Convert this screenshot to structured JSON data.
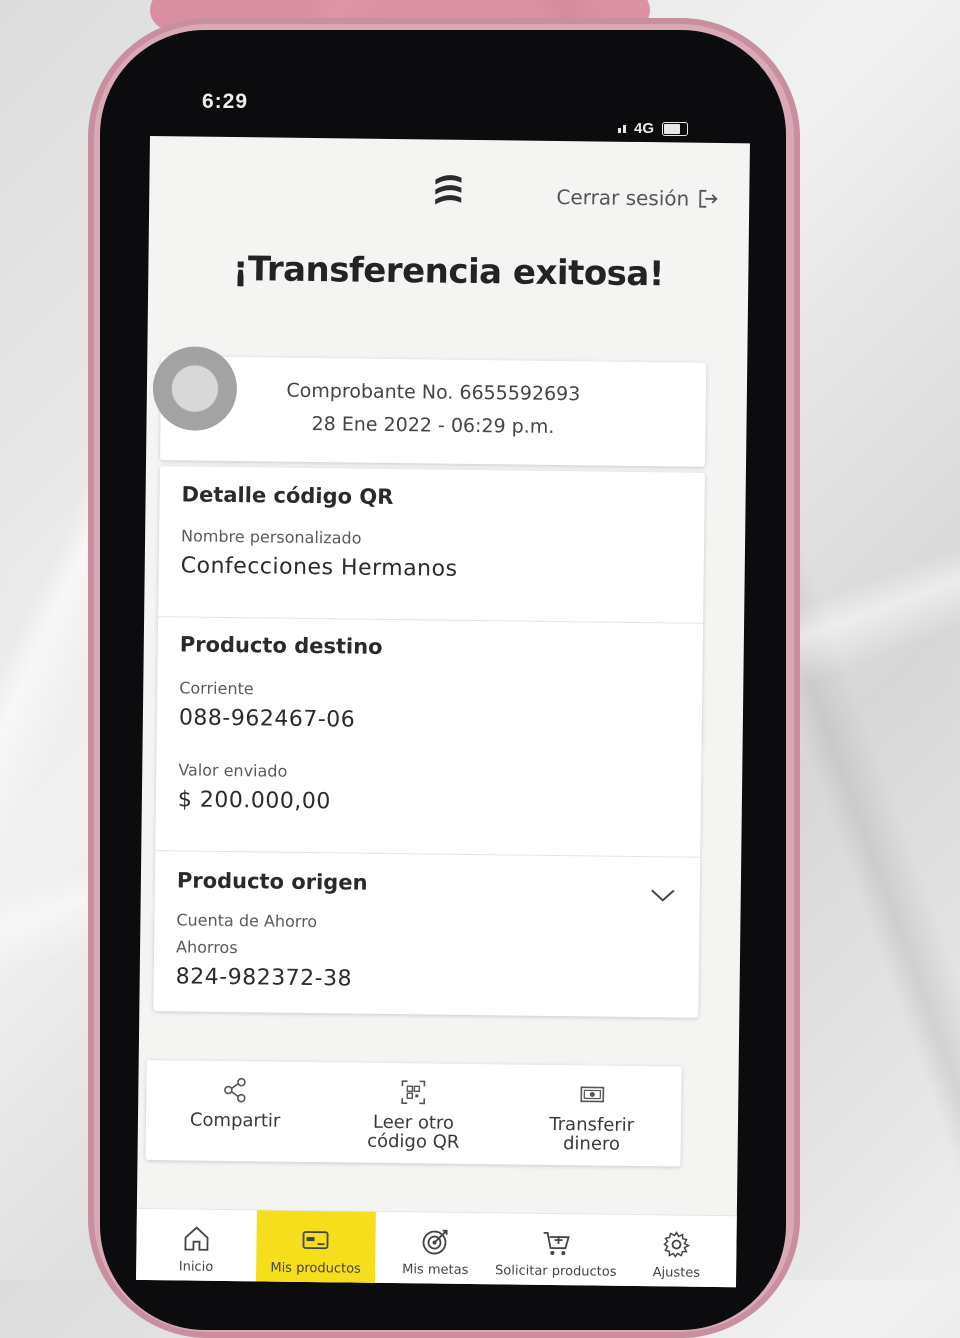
{
  "status_bar": {
    "time": "6:29",
    "network": "4G"
  },
  "header": {
    "logout_label": "Cerrar sesión"
  },
  "title": "¡Transferencia exitosa!",
  "receipt": {
    "voucher": "Comprobante No. 6655592693",
    "datetime": "28 Ene 2022 - 06:29 p.m."
  },
  "qr_detail": {
    "title": "Detalle código QR",
    "custom_name_label": "Nombre personalizado",
    "custom_name_value": "Confecciones Hermanos"
  },
  "destination": {
    "title": "Producto destino",
    "type_label": "Corriente",
    "account": "088-962467-06",
    "amount_label": "Valor enviado",
    "amount": "$ 200.000,00"
  },
  "origin": {
    "title": "Producto origen",
    "type_label": "Cuenta de Ahorro",
    "subtype_label": "Ahorros",
    "account": "824-982372-38"
  },
  "actions": [
    {
      "label": "Compartir",
      "icon": "share-icon"
    },
    {
      "label": "Leer otro\ncódigo QR",
      "icon": "qr-code-icon"
    },
    {
      "label": "Transferir\ndinero",
      "icon": "money-icon"
    }
  ],
  "nav": [
    {
      "label": "Inicio",
      "icon": "home-icon",
      "active": false
    },
    {
      "label": "Mis productos",
      "icon": "card-icon",
      "active": true
    },
    {
      "label": "Mis metas",
      "icon": "target-icon",
      "active": false
    },
    {
      "label": "Solicitar productos",
      "icon": "cart-add-icon",
      "active": false
    },
    {
      "label": "Ajustes",
      "icon": "gear-icon",
      "active": false
    }
  ],
  "colors": {
    "nav_active": "#f5de1c",
    "text_dark": "#232323"
  }
}
